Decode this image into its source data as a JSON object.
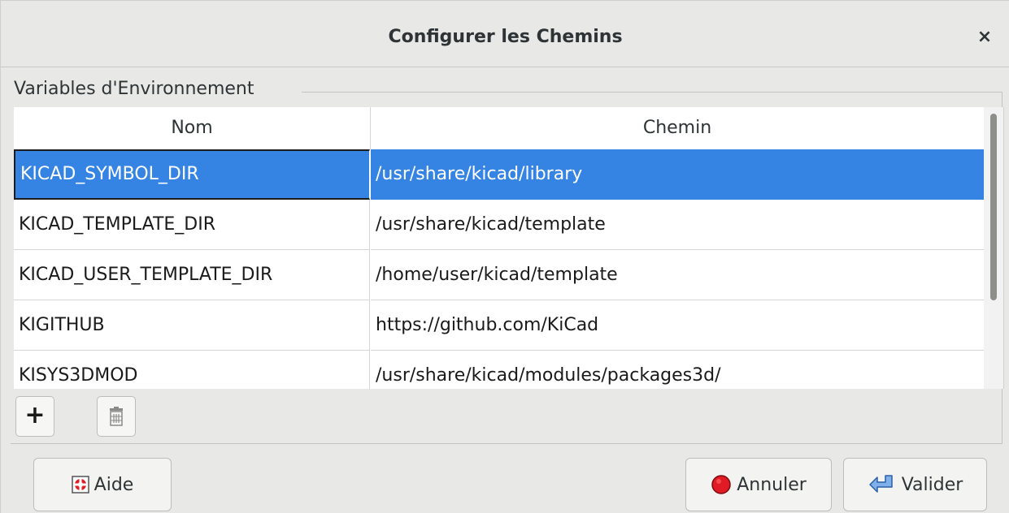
{
  "dialog": {
    "title": "Configurer les Chemins",
    "close_label": "×",
    "group_label": "Variables d'Environnement"
  },
  "table": {
    "headers": {
      "name": "Nom",
      "path": "Chemin"
    },
    "rows": [
      {
        "name": "KICAD_SYMBOL_DIR",
        "path": "/usr/share/kicad/library",
        "selected": true
      },
      {
        "name": "KICAD_TEMPLATE_DIR",
        "path": "/usr/share/kicad/template",
        "selected": false
      },
      {
        "name": "KICAD_USER_TEMPLATE_DIR",
        "path": "/home/user/kicad/template",
        "selected": false
      },
      {
        "name": "KIGITHUB",
        "path": "https://github.com/KiCad",
        "selected": false
      },
      {
        "name": "KISYS3DMOD",
        "path": "/usr/share/kicad/modules/packages3d/",
        "selected": false
      }
    ]
  },
  "toolbar": {
    "add_label": "+",
    "delete_icon": "trash-icon"
  },
  "buttons": {
    "help_label": "Aide",
    "cancel_label": "Annuler",
    "ok_label": "Valider"
  },
  "colors": {
    "selection": "#3584e4",
    "cancel_icon": "#e01b24",
    "ok_icon": "#3d7fd6"
  }
}
